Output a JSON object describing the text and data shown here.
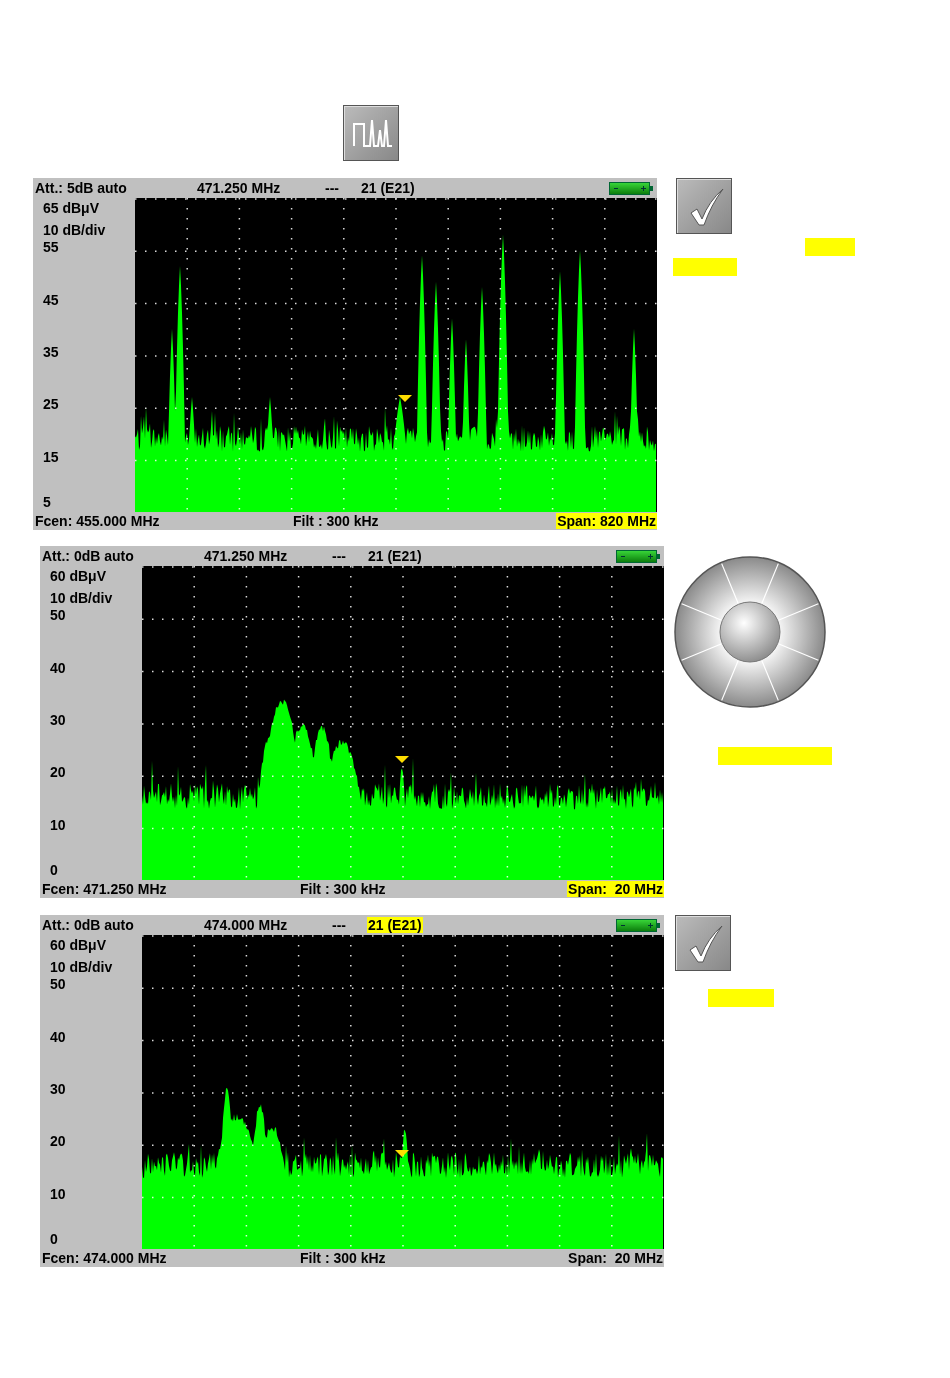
{
  "panels": [
    {
      "attenuation": "Att.: 5dB auto",
      "frequency": "471.250 MHz",
      "separator": "---",
      "channel": "21 (E21)",
      "channel_highlighted": false,
      "reference": "65 dBμV",
      "scale": "10 dB/div",
      "y_labels": [
        "55",
        "45",
        "35",
        "25",
        "15",
        "5"
      ],
      "center": "Fcen: 455.000 MHz",
      "filter": "Filt : 300 kHz",
      "span": "Span: 820 MHz",
      "span_highlighted": true,
      "side_control": {
        "kind": "check"
      }
    },
    {
      "attenuation": "Att.: 0dB auto",
      "frequency": "471.250 MHz",
      "separator": "---",
      "channel": "21 (E21)",
      "channel_highlighted": false,
      "reference": "60 dBμV",
      "scale": "10 dB/div",
      "y_labels": [
        "50",
        "40",
        "30",
        "20",
        "10",
        "0"
      ],
      "center": "Fcen: 471.250 MHz",
      "filter": "Filt : 300 kHz",
      "span": "Span:  20 MHz",
      "span_highlighted": true,
      "side_control": {
        "kind": "dial"
      }
    },
    {
      "attenuation": "Att.: 0dB auto",
      "frequency": "474.000 MHz",
      "separator": "---",
      "channel": "21 (E21)",
      "channel_highlighted": true,
      "reference": "60 dBμV",
      "scale": "10 dB/div",
      "y_labels": [
        "50",
        "40",
        "30",
        "20",
        "10",
        "0"
      ],
      "center": "Fcen: 474.000 MHz",
      "filter": "Filt : 300 kHz",
      "span": "Span:  20 MHz",
      "span_highlighted": false,
      "side_control": {
        "kind": "check"
      }
    }
  ]
}
